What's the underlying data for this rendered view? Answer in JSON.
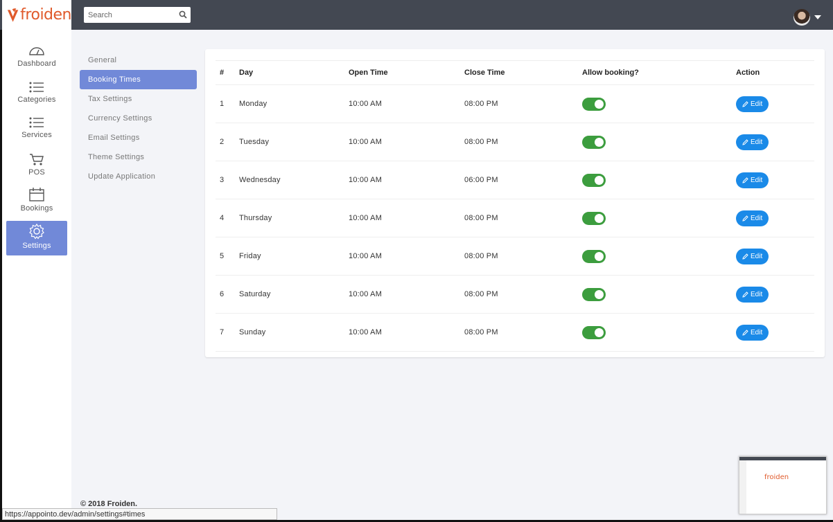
{
  "brand": {
    "name": "froiden"
  },
  "search": {
    "placeholder": "Search"
  },
  "sidebar": {
    "items": [
      {
        "label": "Dashboard",
        "icon": "dashboard-icon"
      },
      {
        "label": "Categories",
        "icon": "list-icon"
      },
      {
        "label": "Services",
        "icon": "list-icon"
      },
      {
        "label": "POS",
        "icon": "cart-icon"
      },
      {
        "label": "Bookings",
        "icon": "calendar-icon"
      },
      {
        "label": "Settings",
        "icon": "gear-icon",
        "active": true
      }
    ]
  },
  "settings_menu": {
    "items": [
      {
        "label": "General"
      },
      {
        "label": "Booking Times",
        "active": true
      },
      {
        "label": "Tax Settings"
      },
      {
        "label": "Currency Settings"
      },
      {
        "label": "Email Settings"
      },
      {
        "label": "Theme Settings"
      },
      {
        "label": "Update Application"
      }
    ]
  },
  "table": {
    "headers": [
      "#",
      "Day",
      "Open Time",
      "Close Time",
      "Allow booking?",
      "Action"
    ],
    "rows": [
      {
        "num": "1",
        "day": "Monday",
        "open": "10:00 AM",
        "close": "08:00 PM",
        "allow": true,
        "action": "Edit"
      },
      {
        "num": "2",
        "day": "Tuesday",
        "open": "10:00 AM",
        "close": "08:00 PM",
        "allow": true,
        "action": "Edit"
      },
      {
        "num": "3",
        "day": "Wednesday",
        "open": "10:00 AM",
        "close": "06:00 PM",
        "allow": true,
        "action": "Edit"
      },
      {
        "num": "4",
        "day": "Thursday",
        "open": "10:00 AM",
        "close": "08:00 PM",
        "allow": true,
        "action": "Edit"
      },
      {
        "num": "5",
        "day": "Friday",
        "open": "10:00 AM",
        "close": "08:00 PM",
        "allow": true,
        "action": "Edit"
      },
      {
        "num": "6",
        "day": "Saturday",
        "open": "10:00 AM",
        "close": "08:00 PM",
        "allow": true,
        "action": "Edit"
      },
      {
        "num": "7",
        "day": "Sunday",
        "open": "10:00 AM",
        "close": "08:00 PM",
        "allow": true,
        "action": "Edit"
      }
    ]
  },
  "footer": {
    "copyright": "© 2018 Froiden."
  },
  "status_bar": {
    "url": "https://appointo.dev/admin/settings#times"
  },
  "thumbnail": {
    "logo_text": "froiden"
  },
  "colors": {
    "topbar": "#434852",
    "accent": "#7189d8",
    "toggle_on": "#3c9d3e",
    "edit_button": "#1a8ae8",
    "brand": "#e05a2b"
  }
}
